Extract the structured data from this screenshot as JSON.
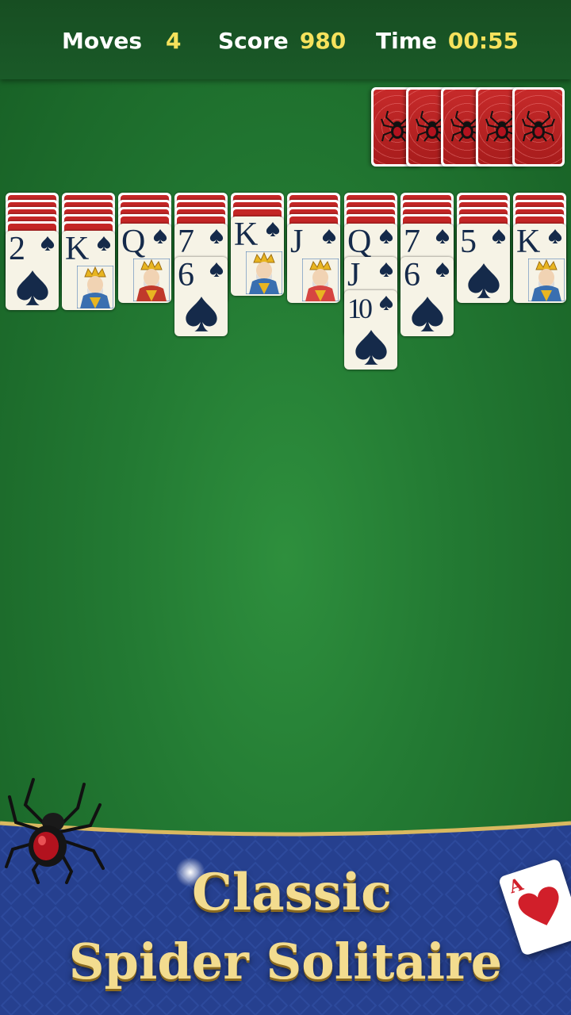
{
  "stats": {
    "moves_label": "Moves",
    "moves_value": "4",
    "score_label": "Score",
    "score_value": "980",
    "time_label": "Time",
    "time_value": "00:55"
  },
  "stock": {
    "piles": 5,
    "icon": "spider-icon"
  },
  "tableau": [
    {
      "hidden": 5,
      "faceup": [
        {
          "rank": "2",
          "suit": "spade",
          "kind": "pip"
        }
      ]
    },
    {
      "hidden": 5,
      "faceup": [
        {
          "rank": "K",
          "suit": "spade",
          "kind": "king"
        }
      ]
    },
    {
      "hidden": 4,
      "faceup": [
        {
          "rank": "Q",
          "suit": "spade",
          "kind": "queen"
        }
      ]
    },
    {
      "hidden": 4,
      "faceup": [
        {
          "rank": "7",
          "suit": "spade",
          "kind": "pip"
        },
        {
          "rank": "6",
          "suit": "spade",
          "kind": "pip"
        }
      ]
    },
    {
      "hidden": 3,
      "faceup": [
        {
          "rank": "K",
          "suit": "spade",
          "kind": "king"
        }
      ]
    },
    {
      "hidden": 4,
      "faceup": [
        {
          "rank": "J",
          "suit": "spade",
          "kind": "jack"
        }
      ]
    },
    {
      "hidden": 4,
      "faceup": [
        {
          "rank": "Q",
          "suit": "spade",
          "kind": "queen"
        },
        {
          "rank": "J",
          "suit": "spade",
          "kind": "jack"
        },
        {
          "rank": "10",
          "suit": "spade",
          "kind": "pip"
        }
      ]
    },
    {
      "hidden": 4,
      "faceup": [
        {
          "rank": "7",
          "suit": "spade",
          "kind": "pip"
        },
        {
          "rank": "6",
          "suit": "spade",
          "kind": "pip"
        }
      ]
    },
    {
      "hidden": 4,
      "faceup": [
        {
          "rank": "5",
          "suit": "spade",
          "kind": "pip"
        }
      ]
    },
    {
      "hidden": 4,
      "faceup": [
        {
          "rank": "K",
          "suit": "spade",
          "kind": "king"
        }
      ]
    }
  ],
  "banner": {
    "line1": "Classic",
    "line2": "Spider Solitaire",
    "ace_rank": "A"
  },
  "colors": {
    "felt": "#237a33",
    "topbar": "#1a5a28",
    "stat_value": "#f6e25c",
    "card_back": "#b52020",
    "banner_blue": "#233c8a",
    "gold": "#f3dc8f"
  }
}
